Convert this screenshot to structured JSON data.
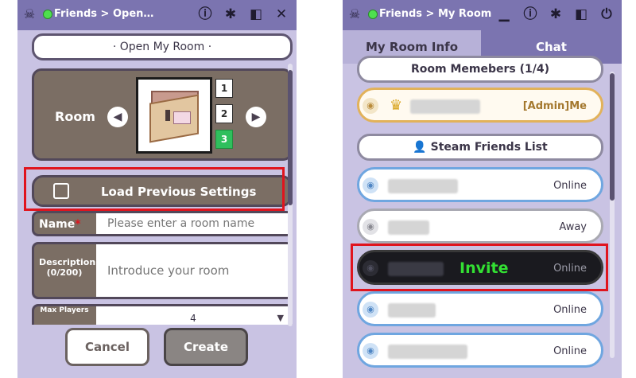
{
  "left": {
    "breadcrumb": "Friends > Open…",
    "header_title": "· Open My Room ·",
    "room_label": "Room",
    "room_slots": [
      "1",
      "2",
      "3"
    ],
    "selected_slot": "3",
    "load_previous_label": "Load Previous Settings",
    "name_label": "Name",
    "name_required_marker": "*",
    "name_placeholder": "Please enter a room name",
    "description_label": "Description",
    "description_counter": "(0/200)",
    "description_placeholder": "Introduce your room",
    "max_players_label": "Max Players",
    "max_players_value": "4",
    "cancel_label": "Cancel",
    "create_label": "Create"
  },
  "right": {
    "breadcrumb": "Friends > My Room",
    "tabs": [
      {
        "label": "My Room Info",
        "active": false
      },
      {
        "label": "Chat",
        "active": true
      }
    ],
    "room_members_header": "Room Memebers (1/4)",
    "admin_tag": "[Admin]Me",
    "steam_friends_header": "Steam Friends List",
    "friends": [
      {
        "status": "Online"
      },
      {
        "status": "Away"
      },
      {
        "status": "Online",
        "invite_label": "Invite"
      },
      {
        "status": "Online"
      },
      {
        "status": "Online"
      }
    ]
  },
  "icons": {
    "app": "skull-icon",
    "info": "info-icon",
    "settings": "gear-icon",
    "window": "window-icon",
    "close": "close-icon",
    "minimize": "minimize-icon",
    "power": "power-icon"
  },
  "colors": {
    "panel_bg": "#c9c3e3",
    "titlebar": "#7b74b0",
    "online_dot": "#4ee04e",
    "highlight": "#e0141e",
    "invite_text": "#33e033",
    "selected_slot": "#2fbf5d"
  }
}
